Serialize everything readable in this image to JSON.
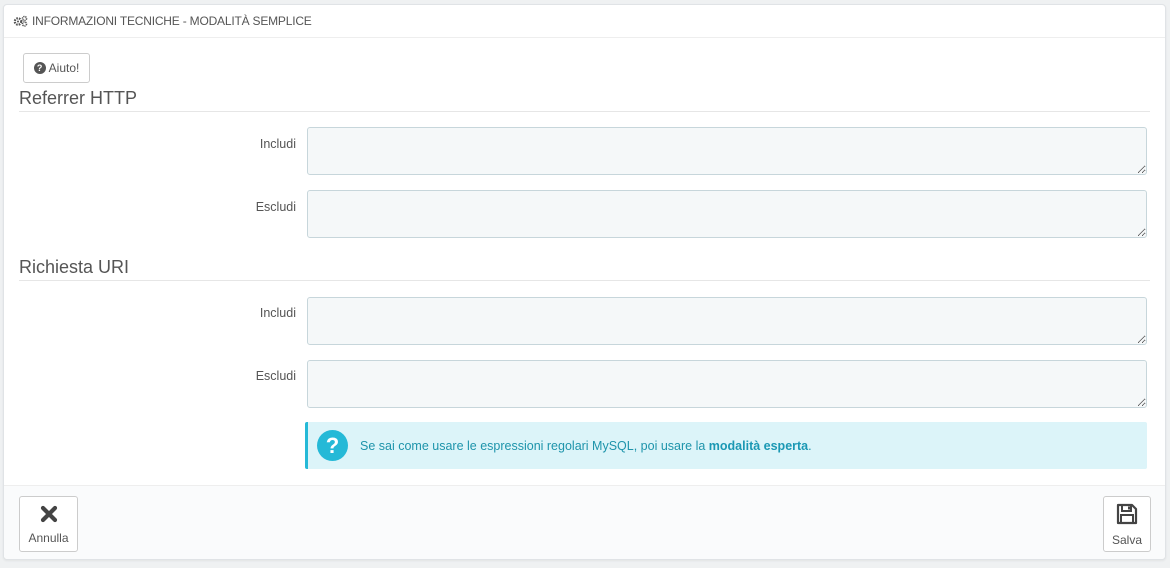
{
  "panel": {
    "title": "INFORMAZIONI TECNICHE - MODALITÀ SEMPLICE",
    "title_icon": "cogs-icon"
  },
  "help_button": {
    "label": "Aiuto!",
    "icon": "question-circle-icon"
  },
  "sections": [
    {
      "title": "Referrer HTTP",
      "fields": [
        {
          "label": "Includi",
          "value": ""
        },
        {
          "label": "Escludi",
          "value": ""
        }
      ]
    },
    {
      "title": "Richiesta URI",
      "fields": [
        {
          "label": "Includi",
          "value": ""
        },
        {
          "label": "Escludi",
          "value": ""
        }
      ]
    }
  ],
  "info_alert": {
    "text_before": "Se sai come usare le espressioni regolari MySQL, poi usare la ",
    "link_text": "modalità esperta",
    "text_after": ".",
    "icon": "question-icon"
  },
  "footer": {
    "cancel_label": "Annulla",
    "cancel_icon": "close-icon",
    "save_label": "Salva",
    "save_icon": "floppy-disk-icon"
  },
  "colors": {
    "accent": "#25b9d7",
    "alert_bg": "#dcf4f9",
    "input_bg": "#f5f8f9"
  }
}
